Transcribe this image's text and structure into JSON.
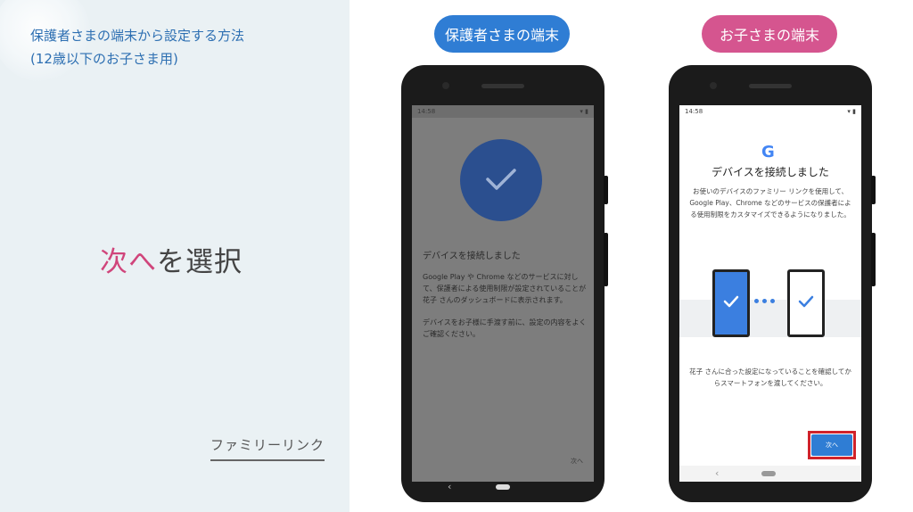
{
  "left_panel": {
    "title_line1": "保護者さまの端末から設定する方法",
    "title_line2": "(12歳以下のお子さま用)",
    "headline_accent": "次へ",
    "headline_rest": "を選択",
    "family_link": "ファミリーリンク"
  },
  "pills": {
    "parent": "保護者さまの端末",
    "child": "お子さまの端末"
  },
  "parent_screen": {
    "status_time": "14:58",
    "title": "デバイスを接続しました",
    "body1": "Google Play や Chrome などのサービスに対して、保護者による使用制限が設定されていることが 花子 さんのダッシュボードに表示されます。",
    "body2": "デバイスをお子様に手渡す前に、設定の内容をよくご確認ください。",
    "next": "次へ"
  },
  "child_screen": {
    "status_time": "14:58",
    "logo": "G",
    "title": "デバイスを接続しました",
    "body": "お使いのデバイスのファミリー リンクを使用して、Google Play、Chrome などのサービスの保護者による使用制限をカスタマイズできるようになりました。",
    "footer": "花子 さんに合った設定になっていることを確認してからスマートフォンを渡してください。",
    "next_button": "次へ"
  },
  "colors": {
    "accent_pink": "#d0457b",
    "parent_blue": "#2f7dd4",
    "child_pink": "#d5558f",
    "highlight_red": "#d0232b"
  }
}
